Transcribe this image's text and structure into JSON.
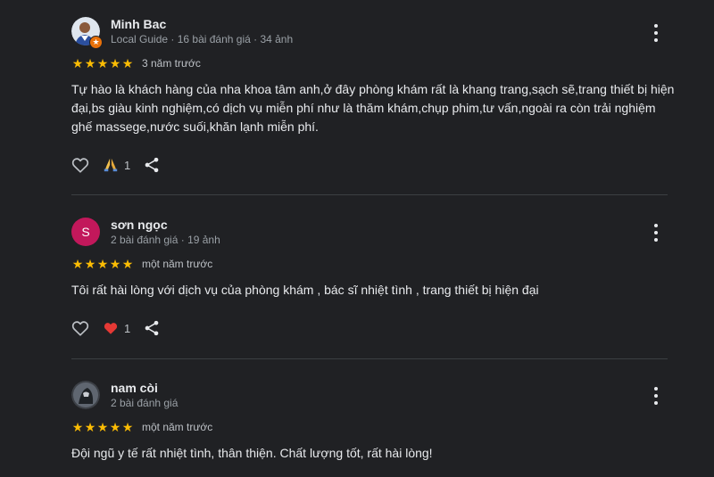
{
  "reviews": [
    {
      "author": "Minh Bac",
      "meta": "Local Guide · 16 bài đánh giá · 34 ảnh",
      "time": "3 năm trước",
      "text": "Tự hào là khách hàng của nha khoa tâm anh,ở đây phòng khám rất là khang trang,sạch sẽ,trang thiết bị hiện đại,bs giàu kinh nghiệm,có dịch vụ miễn phí như là thăm khám,chụp phim,tư vấn,ngoài ra còn trải nghiệm ghế massege,nước suối,khăn lạnh miễn phí.",
      "reaction_icon": "folded-hands",
      "reaction_count": "1",
      "rating": 5
    },
    {
      "author": "sơn ngọc",
      "avatar_letter": "S",
      "meta": "2 bài đánh giá · 19 ảnh",
      "time": "một năm trước",
      "text": "Tôi rất hài lòng với dịch vụ của phòng khám , bác sĩ nhiệt tình , trang thiết bị hiện đại",
      "reaction_icon": "red-heart",
      "reaction_count": "1",
      "rating": 5
    },
    {
      "author": "nam còi",
      "meta": "2 bài đánh giá",
      "time": "một năm trước",
      "text": "Đội ngũ y tế rất nhiệt tình, thân thiện. Chất lượng tốt, rất hài lòng!",
      "rating": 5
    }
  ],
  "colors": {
    "background": "#202124",
    "star": "#fbbc04",
    "avatar_s": "#c2185b",
    "heart": "#e53935"
  }
}
